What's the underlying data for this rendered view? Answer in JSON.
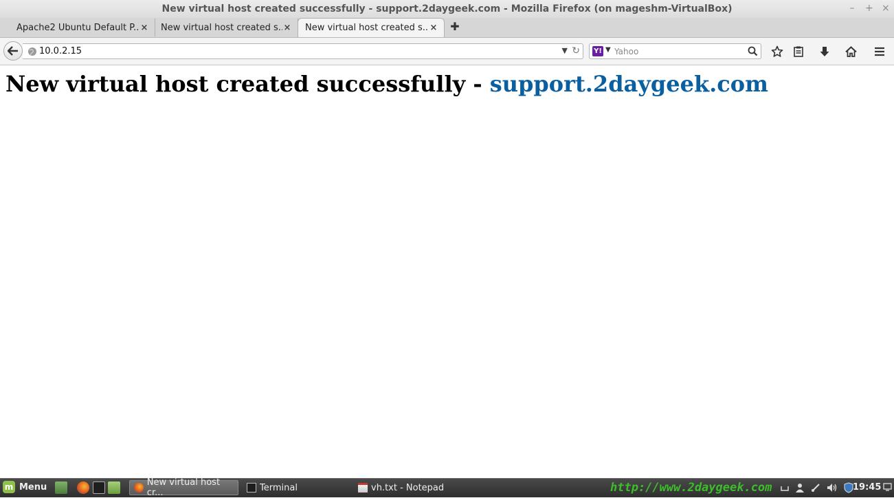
{
  "window": {
    "title": "New virtual host created successfully - support.2daygeek.com - Mozilla Firefox (on mageshm-VirtualBox)",
    "controls": {
      "minimize": "–",
      "maximize": "+",
      "close": "×"
    }
  },
  "tabs": [
    {
      "label": "Apache2 Ubuntu Default P...",
      "close": "×",
      "active": false
    },
    {
      "label": "New virtual host created s...",
      "close": "×",
      "active": false
    },
    {
      "label": "New virtual host created s...",
      "close": "×",
      "active": true
    }
  ],
  "new_tab_label": "✚",
  "navbar": {
    "url": "10.0.2.15",
    "url_dropdown": "▼",
    "reload_icon": "↻",
    "search_engine": "Y!",
    "search_dropdown": "▼",
    "search_placeholder": "Yahoo"
  },
  "page": {
    "heading_text": "New virtual host created successfully - ",
    "heading_link": "support.2daygeek.com"
  },
  "taskbar": {
    "menu_label": "Menu",
    "menu_logo": "m",
    "tasks": [
      {
        "label": "New virtual host cr...",
        "active": true
      },
      {
        "label": "Terminal",
        "active": false
      },
      {
        "label": "vh.txt - Notepad",
        "active": false
      }
    ],
    "watermark": "http://www.2daygeek.com",
    "clock": "19:45"
  },
  "colors": {
    "link": "#0a5fa0",
    "watermark": "#3cbd2a",
    "mint_logo": "#8fc14a",
    "yahoo": "#6a1fa0"
  }
}
